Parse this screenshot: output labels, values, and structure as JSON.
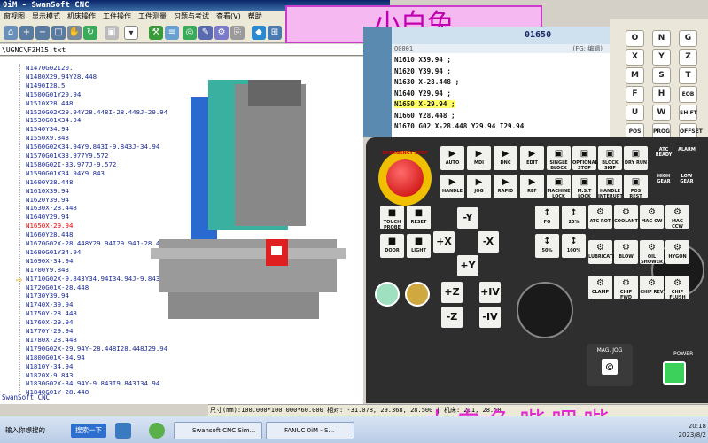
{
  "window": {
    "title": "0iM - SwanSoft CNC"
  },
  "menu": [
    "窗视图",
    "显示模式",
    "机床操作",
    "工件操作",
    "工件测量",
    "习题与考试",
    "查看(V)",
    "帮助"
  ],
  "program_pane": {
    "title": "\\UGNC\\FZH15.txt",
    "lines": [
      "N1470G02I20.",
      "N1480X29.94Y28.448",
      "N1490I28.5",
      "N1500G01Y29.94",
      "N1510X28.448",
      "N1520G02X29.94Y28.448I-28.448J-29.94",
      "N1530G01X34.94",
      "N1540Y34.94",
      "N1550X9.843",
      "N1560G02X34.94Y9.843I-9.843J-34.94",
      "N1570G01X33.977Y9.572",
      "N1580G02I-33.977J-9.572",
      "N1590G01X34.94Y9.843",
      "N1600Y28.448",
      "N1610X39.94",
      "N1620Y39.94",
      "N1630X-28.448",
      "N1640Y29.94",
      "N1650X-29.94",
      "N1660Y28.448",
      "N1670G02X-28.448Y29.94I29.94J-28.448",
      "N1680G01Y34.94",
      "N1690X-34.94",
      "N1700Y9.843",
      "N1710G02X-9.843Y34.94I34.94J-9.843",
      "N1720G01X-28.448",
      "N1730Y39.94",
      "N1740X-39.94",
      "N1750Y-28.448",
      "N1760X-29.94",
      "N1770Y-29.94",
      "N1780X-28.448",
      "N1790G02X-29.94Y-28.448I28.448J29.94",
      "N1800G01X-34.94",
      "N1810Y-34.94",
      "N1820X-9.843",
      "N1830G02X-34.94Y-9.843I9.843J34.94",
      "N1840G01Y-28.448"
    ],
    "current_index": 18,
    "footer": "SwanSoft CNC"
  },
  "banner": {
    "text": "小白兔"
  },
  "cnc_screen": {
    "program_no": "01650",
    "program_id": "O0001",
    "mode": "(FG: 编辑)",
    "lines": [
      "N1610 X39.94 ;",
      "N1620 Y39.94 ;",
      "N1630 X-28.448 ;",
      "N1640 Y29.94 ;",
      "N1650 X-29.94 ;",
      "N1660 Y28.448 ;",
      "N1670 G02 X-28.448 Y29.94 I29.94"
    ],
    "highlight_index": 4
  },
  "keypad": {
    "keys": [
      "O",
      "N",
      "G",
      "X",
      "Y",
      "Z",
      "M",
      "S",
      "T",
      "F",
      "H",
      "EOB",
      "U",
      "W",
      "SHIFT",
      "POS",
      "PROG",
      "OFFSET"
    ]
  },
  "panel": {
    "estop_label": "EMERGENCY STOP",
    "mode_buttons": [
      "AUTO",
      "MDI",
      "DNC",
      "EDIT",
      "HANDLE",
      "JOG",
      "RAPID",
      "REF"
    ],
    "func_buttons": [
      "SINGLE BLOCK",
      "OPTIONAL STOP",
      "BLOCK SKIP",
      "DRY RUN",
      "MACHINE LOCK",
      "M.S.T LOCK",
      "HANDLE INTERUPT",
      "POS REST"
    ],
    "atc_labels": [
      "ATC READY",
      "ALARM",
      "HIGH GEAR",
      "LOW GEAR"
    ],
    "jog_axes": [
      "-Y",
      "+X",
      "-X",
      "+Y",
      "+Z",
      "+IV",
      "-Z",
      "-IV"
    ],
    "feed_labels": [
      "FO",
      "25%",
      "50%",
      "100%"
    ],
    "spindle_buttons": [
      "ATC ROT",
      "COOLANT",
      "MAG CW",
      "MAG CCW",
      "LUBRICATE",
      "BLOW",
      "OIL SHOWER",
      "HYGON",
      "CLAMP",
      "CHIP FWD",
      "CHIP REV",
      "CHIP FLUSH"
    ],
    "misc_buttons": [
      "TOUCH PROBE",
      "RESET",
      "DOOR",
      "LIGHT"
    ],
    "mag_jog": "MAG. JOG",
    "power": "POWER"
  },
  "statusbar": {
    "text": "尺寸(mm):100.000*100.000*60.000  相对:   -31.078,   29.368,   28.500 | 机床:  2.1,    28.50"
  },
  "taskbar": {
    "input_label": "输入你想搜的",
    "search_button": "搜索一下",
    "tasks": [
      "Swansoft CNC Sim...",
      "FANUC 0iM - S..."
    ],
    "clock_time": "20:18",
    "clock_date": "2023/8/2"
  },
  "watermark": {
    "text": "小白兔哔哩哔"
  },
  "colors": {
    "accent": "#1a2a9a",
    "current_line": "#e00000",
    "highlight": "#ffff66",
    "banner_bg": "#f5b8f0"
  }
}
